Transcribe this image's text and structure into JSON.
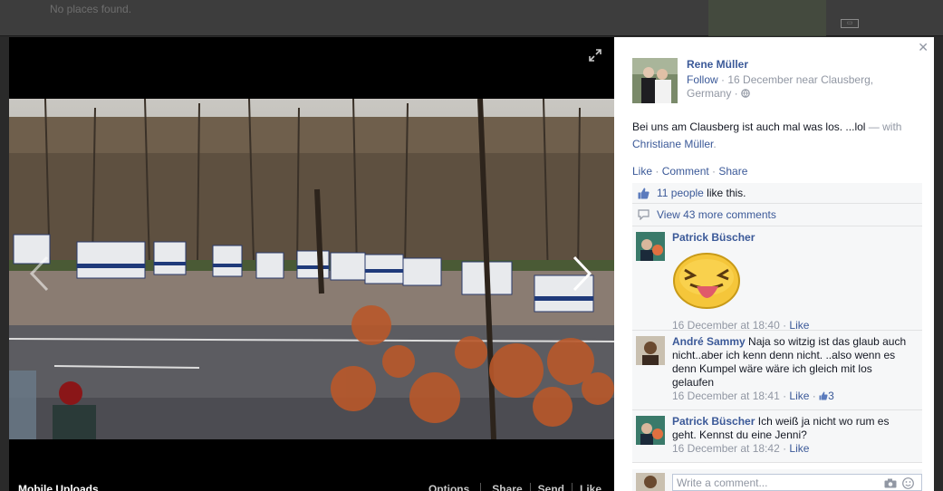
{
  "background": {
    "notice": "No places found."
  },
  "photo": {
    "album": "Mobile Uploads",
    "actions": [
      "Options",
      "Share",
      "Send",
      "Like"
    ]
  },
  "post": {
    "author": "Rene Müller",
    "follow": "Follow",
    "meta": " · 16 December near Clausberg, Germany · ",
    "text": "Bei uns am Clausberg ist auch mal was los. ...lol",
    "with_prefix": " — with ",
    "tagged": "Christiane Müller",
    "with_suffix": ".",
    "actions": {
      "like": "Like",
      "comment": "Comment",
      "share": "Share",
      "sep": " · "
    }
  },
  "ufi": {
    "likes_link": "11 people",
    "likes_suffix": " like this.",
    "more_comments": "View 43 more comments"
  },
  "comments": [
    {
      "name": "Patrick Büscher",
      "text": "",
      "time": "16 December at 18:40",
      "like": "Like",
      "likes": ""
    },
    {
      "name": "André Sammy",
      "text": "Naja so witzig ist das glaub auch nicht..aber ich kenn denn nicht. ..also wenn es denn Kumpel wäre wäre ich gleich mit los gelaufen",
      "time": "16 December at 18:41",
      "like": "Like",
      "likes": "3"
    },
    {
      "name": "Patrick Büscher",
      "text": "Ich weiß ja nicht wo rum es geht. Kennst du eine Jenni?",
      "time": "16 December at 18:42",
      "like": "Like",
      "likes": ""
    }
  ],
  "composer": {
    "placeholder": "Write a comment..."
  },
  "icons": [
    "close-icon",
    "expand-icon",
    "prev-arrow-icon",
    "next-arrow-icon",
    "globe-icon",
    "thumbs-up-icon",
    "comment-bubble-icon",
    "camera-icon",
    "smiley-icon",
    "tongue-sticker"
  ],
  "colors": {
    "link": "#3b5998",
    "muted": "#9197a3",
    "ufi_bg": "#f6f7f8"
  }
}
